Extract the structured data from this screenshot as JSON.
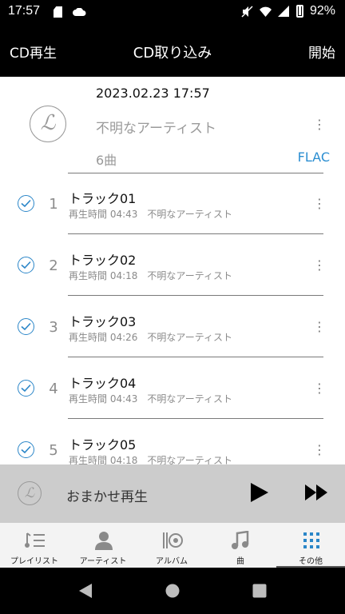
{
  "status_bar": {
    "time": "17:57",
    "battery_percent": "92%"
  },
  "header": {
    "left_label": "CD再生",
    "title": "CD取り込み",
    "right_label": "開始"
  },
  "album": {
    "datetime": "2023.02.23 17:57",
    "artist": "不明なアーティスト",
    "track_count": "6曲",
    "format": "FLAC"
  },
  "tracks": [
    {
      "number": "1",
      "title": "トラック01",
      "duration": "再生時間 04:43",
      "artist": "不明なアーティスト",
      "checked": true
    },
    {
      "number": "2",
      "title": "トラック02",
      "duration": "再生時間 04:18",
      "artist": "不明なアーティスト",
      "checked": true
    },
    {
      "number": "3",
      "title": "トラック03",
      "duration": "再生時間 04:26",
      "artist": "不明なアーティスト",
      "checked": true
    },
    {
      "number": "4",
      "title": "トラック04",
      "duration": "再生時間 04:43",
      "artist": "不明なアーティスト",
      "checked": true
    },
    {
      "number": "5",
      "title": "トラック05",
      "duration": "再生時間 04:18",
      "artist": "不明なアーティスト",
      "checked": true
    }
  ],
  "player": {
    "label": "おまかせ再生"
  },
  "nav": {
    "items": [
      {
        "label": "プレイリスト",
        "icon": "playlist-icon"
      },
      {
        "label": "アーティスト",
        "icon": "artist-icon"
      },
      {
        "label": "アルバム",
        "icon": "album-icon"
      },
      {
        "label": "曲",
        "icon": "music-note-icon"
      },
      {
        "label": "その他",
        "icon": "grid-icon",
        "active": true
      }
    ]
  },
  "colors": {
    "accent": "#2b8ed1",
    "header_bg": "#000000",
    "player_bg": "#cccccc",
    "active_nav": "#2b86c8"
  }
}
